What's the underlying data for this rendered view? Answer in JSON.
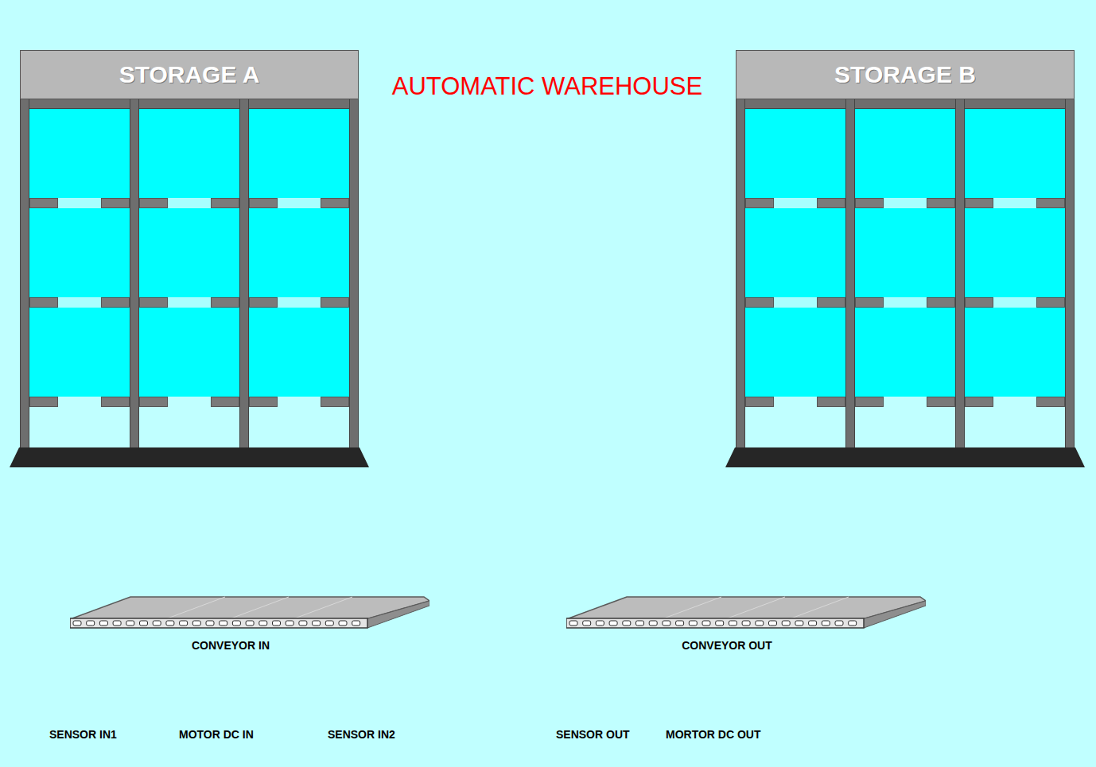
{
  "window": {
    "title": "AUTOMATIC WAREHOUSE"
  },
  "storages": [
    {
      "title": "STORAGE A",
      "slots": [
        {
          "occupied": false
        },
        {
          "occupied": false
        },
        {
          "occupied": false
        },
        {
          "occupied": false
        },
        {
          "occupied": false
        },
        {
          "occupied": false
        },
        {
          "occupied": false
        },
        {
          "occupied": false
        },
        {
          "occupied": false
        }
      ]
    },
    {
      "title": "STORAGE B",
      "slots": [
        {
          "occupied": false
        },
        {
          "occupied": false
        },
        {
          "occupied": false
        },
        {
          "occupied": false
        },
        {
          "occupied": false
        },
        {
          "occupied": false
        },
        {
          "occupied": false
        },
        {
          "occupied": false
        },
        {
          "occupied": false
        }
      ]
    }
  ],
  "conveyors": [
    {
      "label": "CONVEYOR IN",
      "io": [
        "SENSOR IN1",
        "MOTOR DC IN",
        "SENSOR IN2"
      ]
    },
    {
      "label": "CONVEYOR OUT",
      "io": [
        "SENSOR OUT",
        "MORTOR DC OUT"
      ]
    }
  ]
}
